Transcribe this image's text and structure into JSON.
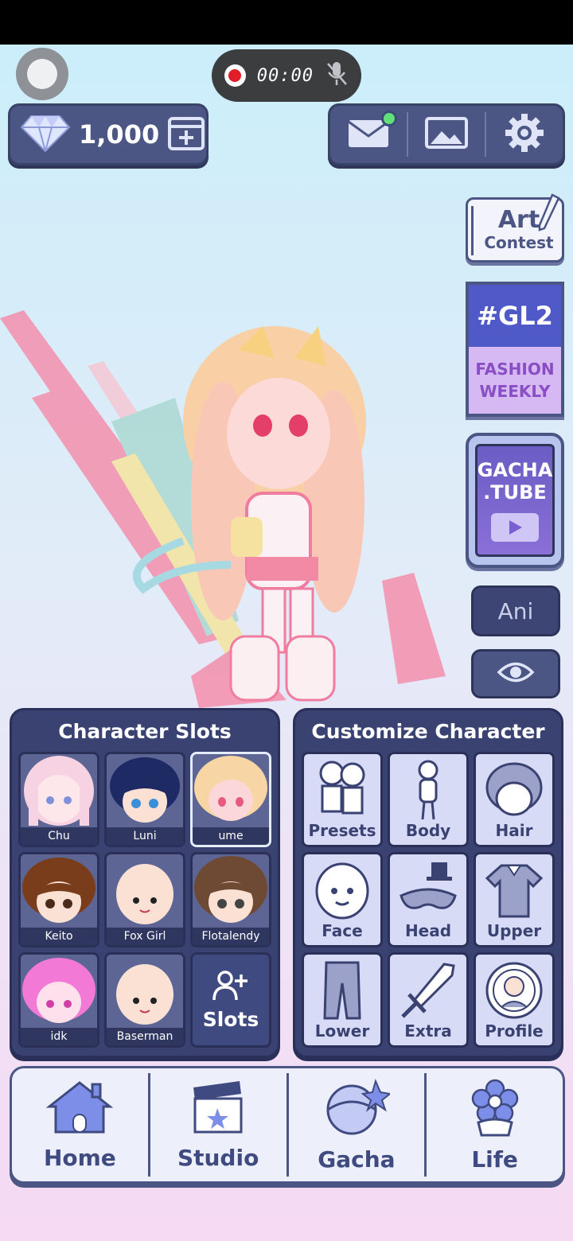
{
  "recorder": {
    "time": "00:00"
  },
  "currency": {
    "gems": "1,000"
  },
  "side": {
    "art_contest_line1": "Art",
    "art_contest_line2": "Contest",
    "fashion_tag": "#GL2",
    "fashion_line1": "FASHION",
    "fashion_line2": "WEEKLY",
    "gachatube_line1": "GACHA",
    "gachatube_line2": ".TUBE",
    "ani_label": "Ani"
  },
  "slots_panel": {
    "title": "Character Slots",
    "slots": [
      {
        "name": "Chu"
      },
      {
        "name": "Luni"
      },
      {
        "name": "ume"
      },
      {
        "name": "Keito"
      },
      {
        "name": "Fox Girl"
      },
      {
        "name": "Flotalendy"
      },
      {
        "name": "idk"
      },
      {
        "name": "Baserman"
      }
    ],
    "add_label": "Slots"
  },
  "customize_panel": {
    "title": "Customize Character",
    "items": [
      {
        "label": "Presets"
      },
      {
        "label": "Body"
      },
      {
        "label": "Hair"
      },
      {
        "label": "Face"
      },
      {
        "label": "Head"
      },
      {
        "label": "Upper"
      },
      {
        "label": "Lower"
      },
      {
        "label": "Extra"
      },
      {
        "label": "Profile"
      }
    ]
  },
  "nav": {
    "home": "Home",
    "studio": "Studio",
    "gacha": "Gacha",
    "life": "Life"
  },
  "colors": {
    "panel": "#3a4272",
    "accent": "#4b5684",
    "notification": "#5fe07a"
  }
}
